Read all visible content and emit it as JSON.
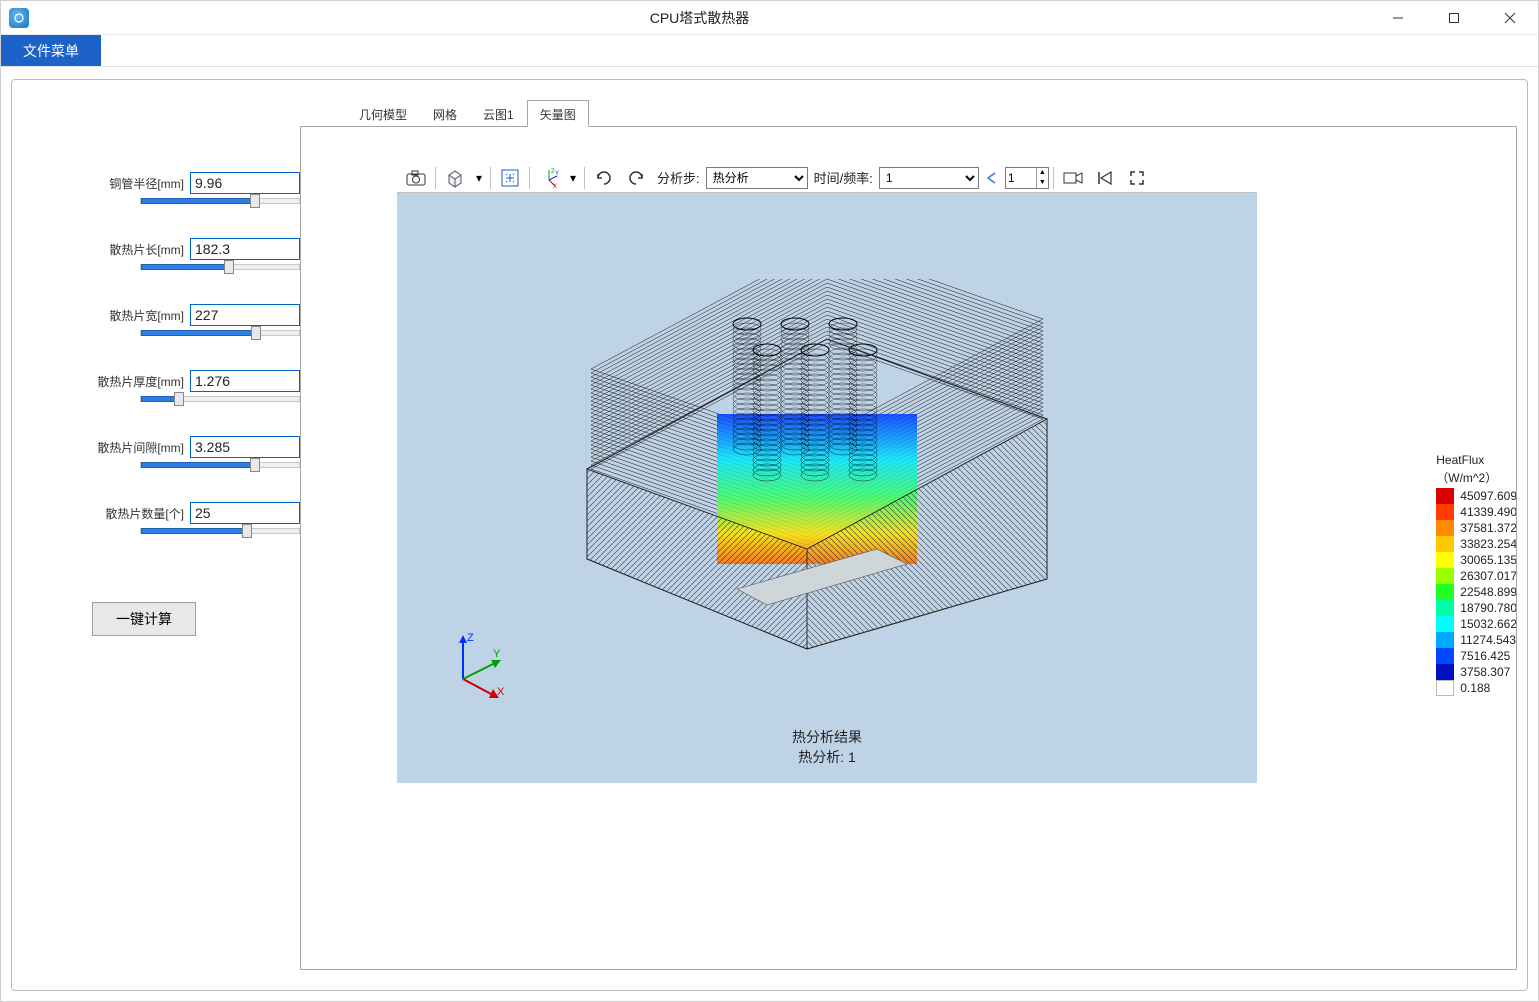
{
  "window": {
    "title": "CPU塔式散热器"
  },
  "menubar": {
    "file": "文件菜单"
  },
  "params": [
    {
      "label": "铜管半径[mm]",
      "value": "9.96",
      "fill": 72
    },
    {
      "label": "散热片长[mm]",
      "value": "182.3",
      "fill": 56
    },
    {
      "label": "散热片宽[mm]",
      "value": "227",
      "fill": 73
    },
    {
      "label": "散热片厚度[mm]",
      "value": "1.276",
      "fill": 24
    },
    {
      "label": "散热片间隙[mm]",
      "value": "3.285",
      "fill": 72
    },
    {
      "label": "散热片数量[个]",
      "value": "25",
      "fill": 67
    }
  ],
  "calc_button": "一键计算",
  "tabs": [
    {
      "label": "几何模型",
      "active": false
    },
    {
      "label": "网格",
      "active": false
    },
    {
      "label": "云图1",
      "active": false
    },
    {
      "label": "矢量图",
      "active": true
    }
  ],
  "toolbar": {
    "step_label": "分析步:",
    "step_select": "热分析",
    "time_label": "时间/频率:",
    "time_select": "1",
    "frame_value": "1"
  },
  "chart_data": {
    "type": "vector_field_3d",
    "legend_title": "HeatFlux",
    "legend_unit": "（W/m^2）",
    "result_title": "热分析结果",
    "result_sub": "热分析: 1",
    "axes": [
      "X",
      "Y",
      "Z"
    ],
    "colorbar": [
      {
        "color": "#d80000",
        "value": "45097.609"
      },
      {
        "color": "#ff3b00",
        "value": "41339.490"
      },
      {
        "color": "#ff8a00",
        "value": "37581.372"
      },
      {
        "color": "#ffc800",
        "value": "33823.254"
      },
      {
        "color": "#ffff00",
        "value": "30065.135"
      },
      {
        "color": "#9aff00",
        "value": "26307.017"
      },
      {
        "color": "#22ff22",
        "value": "22548.899"
      },
      {
        "color": "#00ffa8",
        "value": "18790.780"
      },
      {
        "color": "#00ffff",
        "value": "15032.662"
      },
      {
        "color": "#00a8ff",
        "value": "11274.543"
      },
      {
        "color": "#0048ff",
        "value": "7516.425"
      },
      {
        "color": "#0010c0",
        "value": "3758.307"
      },
      {
        "color": "#ffffff",
        "value": "0.188"
      }
    ]
  }
}
